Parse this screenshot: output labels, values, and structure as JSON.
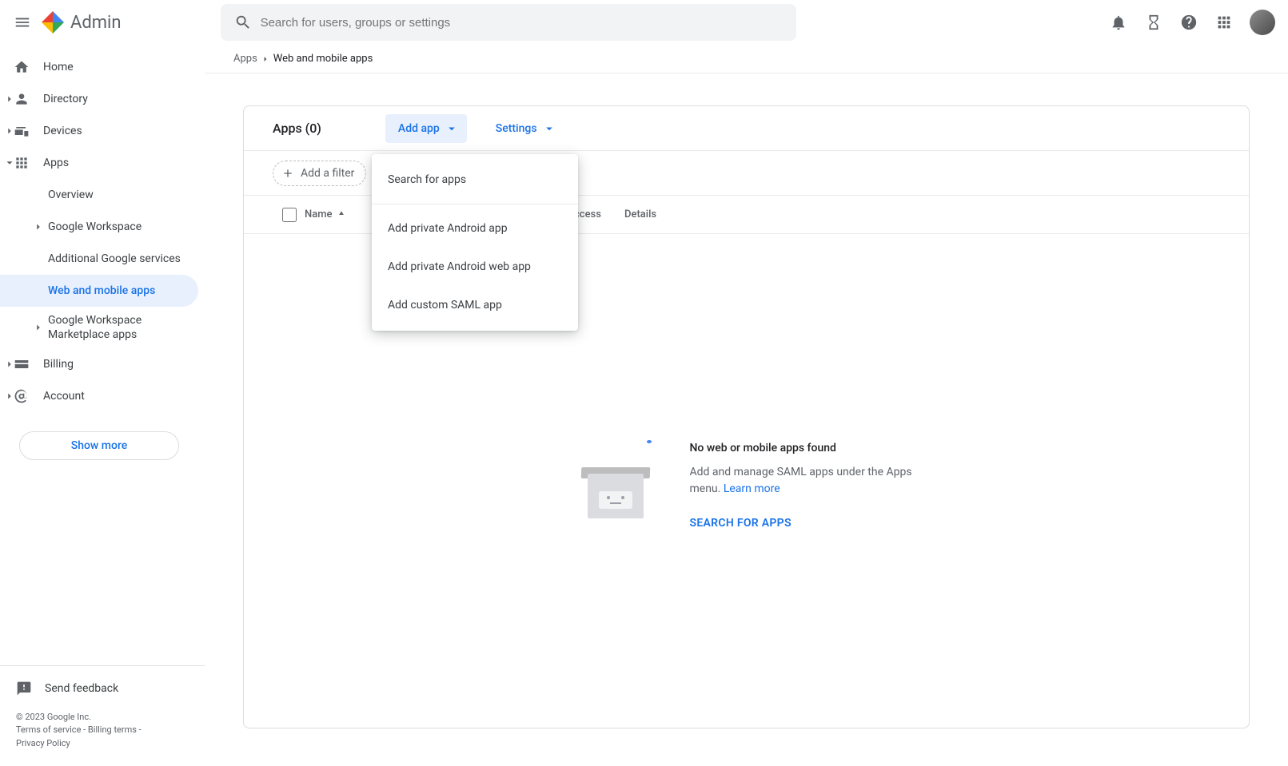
{
  "brand": {
    "name": "Admin"
  },
  "search": {
    "placeholder": "Search for users, groups or settings"
  },
  "breadcrumbs": {
    "items": [
      {
        "label": "Apps"
      },
      {
        "label": "Web and mobile apps",
        "current": true
      }
    ]
  },
  "sidebar": {
    "items": [
      {
        "label": "Home",
        "icon": "home",
        "expandable": false
      },
      {
        "label": "Directory",
        "icon": "person",
        "expandable": true
      },
      {
        "label": "Devices",
        "icon": "devices",
        "expandable": true
      },
      {
        "label": "Apps",
        "icon": "apps",
        "expandable": true,
        "expanded": true
      },
      {
        "label": "Billing",
        "icon": "card",
        "expandable": true
      },
      {
        "label": "Account",
        "icon": "at",
        "expandable": true
      }
    ],
    "apps_children": [
      {
        "label": "Overview"
      },
      {
        "label": "Google Workspace",
        "expandable": true
      },
      {
        "label": "Additional Google services"
      },
      {
        "label": "Web and mobile apps",
        "active": true
      },
      {
        "label": "Google Workspace Marketplace apps",
        "expandable": true
      }
    ],
    "show_more": "Show more",
    "feedback": "Send feedback",
    "legal": {
      "copyright": "© 2023 Google Inc.",
      "terms": "Terms of service",
      "billing": "Billing terms",
      "privacy": "Privacy Policy",
      "sep": " - "
    }
  },
  "card": {
    "title": "Apps (0)",
    "add_app": "Add app",
    "settings": "Settings",
    "filter": "Add a filter",
    "columns": {
      "name": "Name",
      "user_access": "User access",
      "details": "Details"
    },
    "empty": {
      "title": "No web or mobile apps found",
      "desc_a": "Add and manage SAML apps under the Apps menu. ",
      "learn_more": "Learn more",
      "cta": "SEARCH FOR APPS"
    }
  },
  "menu": {
    "items": [
      {
        "label": "Search for apps"
      },
      {
        "label": "Add private Android app"
      },
      {
        "label": "Add private Android web app"
      },
      {
        "label": "Add custom SAML app"
      }
    ]
  },
  "icons": {
    "menu": "menu-icon",
    "search": "search-icon",
    "bell": "bell-icon",
    "hourglass": "hourglass-icon",
    "help": "help-icon",
    "grid": "apps-grid-icon"
  }
}
